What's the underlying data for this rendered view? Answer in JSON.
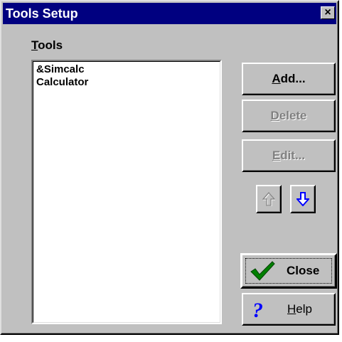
{
  "window": {
    "title": "Tools Setup",
    "close_glyph": "×"
  },
  "tools": {
    "label_mnemonic": "T",
    "label_rest": "ools",
    "items": [
      "&Simcalc",
      "Calculator"
    ]
  },
  "buttons": {
    "add": {
      "mnemonic": "A",
      "rest": "dd...",
      "enabled": true
    },
    "delete": {
      "mnemonic": "D",
      "rest": "elete",
      "enabled": false
    },
    "edit": {
      "mnemonic": "E",
      "rest": "dit...",
      "enabled": false
    },
    "move_up": {
      "icon": "up-arrow-icon",
      "enabled": false
    },
    "move_down": {
      "icon": "down-arrow-icon",
      "enabled": true
    },
    "close": {
      "label": "Close",
      "icon": "checkmark-icon",
      "default": true
    },
    "help": {
      "mnemonic": "H",
      "rest": "elp",
      "icon": "question-mark-icon"
    }
  },
  "colors": {
    "title_bar": "#000080",
    "face": "#c0c0c0",
    "check_green": "#008000",
    "help_blue": "#0000ff",
    "arrow_blue": "#0000ff",
    "disabled_text": "#808080"
  }
}
